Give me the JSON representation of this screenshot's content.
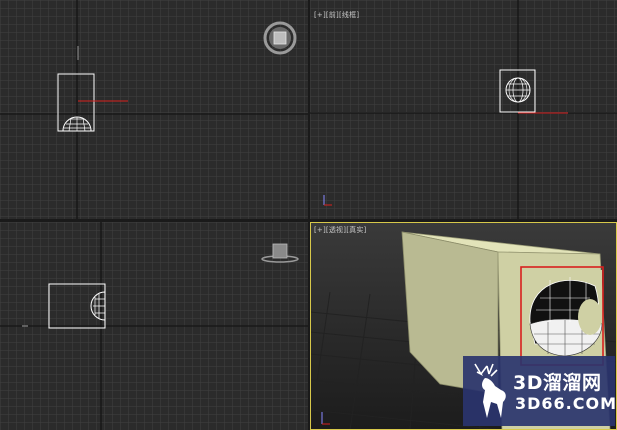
{
  "viewports": {
    "top": {
      "label": "[+][前][线框]"
    },
    "right": {
      "label": "[+][顶][线框]"
    },
    "left": {
      "label": ""
    },
    "perspective": {
      "label": "[+][透视][真实]"
    }
  },
  "colors": {
    "background": "#2b2b2b",
    "grid": "#3f3f3f",
    "grid_major": "#1b1b1b",
    "object_wire": "#ffffff",
    "cube_face": "#cfd0a4",
    "selection": "#d8201e",
    "active_border": "#d7c84a",
    "watermark_bg": "#2a346e"
  },
  "watermark": {
    "line1": "3D溜溜网",
    "line2": "3D66.COM"
  },
  "icons": {
    "viewcube": "viewcube-icon",
    "mini_viewcube": "mini-viewcube-icon",
    "axis_tripod": "axis-tripod-icon",
    "deer_logo": "deer-logo-icon"
  }
}
